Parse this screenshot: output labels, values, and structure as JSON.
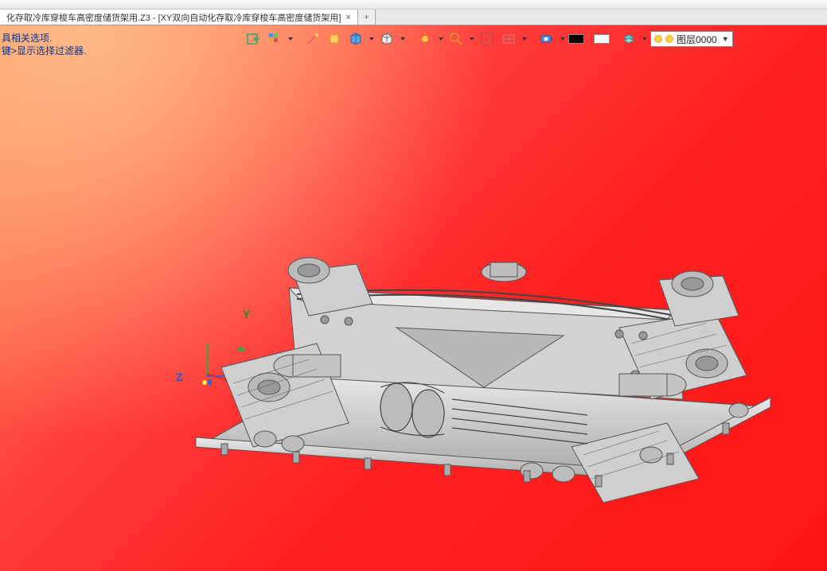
{
  "menubar": {
    "spacer": " "
  },
  "tabs": {
    "active_label": "化存取冷库穿梭车高密度储货架用.Z3 - [XY双向自动化存取冷库穿梭车高密度储货架用]",
    "close_glyph": "×",
    "add_glyph": "+"
  },
  "hints": {
    "line1": "具相关选项.",
    "line2": "键>显示选择过滤器."
  },
  "toolbar": {
    "icons": [
      {
        "name": "import-icon"
      },
      {
        "name": "palette-icon",
        "dropdown": true
      },
      {
        "name": "separator"
      },
      {
        "name": "wand-icon"
      },
      {
        "name": "highlight-icon"
      },
      {
        "name": "cube-shade-icon",
        "dropdown": true
      },
      {
        "name": "cube-wire-icon",
        "dropdown": true
      },
      {
        "name": "separator"
      },
      {
        "name": "sun-icon",
        "dropdown": true
      },
      {
        "name": "zoom-icon",
        "dropdown": true
      },
      {
        "name": "fit-icon"
      },
      {
        "name": "grid-icon",
        "dropdown": true
      },
      {
        "name": "separator"
      },
      {
        "name": "camera-icon",
        "dropdown": true
      },
      {
        "name": "swatch-black"
      },
      {
        "name": "swatch-white"
      },
      {
        "name": "layer-plane-icon",
        "dropdown": true
      }
    ],
    "layer": {
      "label": "图层0000"
    }
  },
  "axes": {
    "y": "Y",
    "z": "Z"
  },
  "colors": {
    "gradient_start": "#ffb27a",
    "gradient_end": "#ff1a1a",
    "model_fill": "#c9c9c9",
    "model_stroke": "#5a5a5a"
  }
}
